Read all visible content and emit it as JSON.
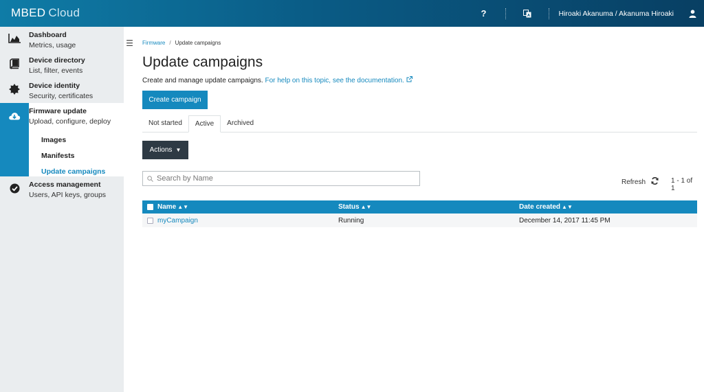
{
  "app": {
    "brand_primary": "MBED",
    "brand_secondary": "Cloud",
    "accent_color": "#1589be"
  },
  "topbar": {
    "help_label": "?",
    "user_name": "Hiroaki Akanuma / Akanuma Hiroaki"
  },
  "sidebar": {
    "items": [
      {
        "title": "Dashboard",
        "subtitle": "Metrics, usage",
        "icon": "chart-icon"
      },
      {
        "title": "Device directory",
        "subtitle": "List, filter, events",
        "icon": "book-icon"
      },
      {
        "title": "Device identity",
        "subtitle": "Security, certificates",
        "icon": "badge-icon"
      },
      {
        "title": "Firmware update",
        "subtitle": "Upload, configure, deploy",
        "icon": "cloud-download-icon",
        "children": [
          "Images",
          "Manifests",
          "Update campaigns"
        ]
      },
      {
        "title": "Access management",
        "subtitle": "Users, API keys, groups",
        "icon": "check-circle-icon"
      }
    ]
  },
  "breadcrumb": {
    "parent": "Firmware",
    "separator": "/",
    "current": "Update campaigns"
  },
  "page": {
    "title": "Update campaigns",
    "description": "Create and manage update campaigns.",
    "doc_link": "For help on this topic, see the documentation.",
    "create_button": "Create campaign"
  },
  "tabs": [
    "Not started",
    "Active",
    "Archived"
  ],
  "active_tab": "Active",
  "toolbar": {
    "actions_label": "Actions",
    "search_placeholder": "Search by Name",
    "refresh_label": "Refresh",
    "pager": "1 - 1 of 1"
  },
  "table": {
    "columns": [
      "Name",
      "Status",
      "Date created"
    ],
    "rows": [
      {
        "name": "myCampaign",
        "status": "Running",
        "date": "December 14, 2017 11:45 PM"
      }
    ]
  }
}
